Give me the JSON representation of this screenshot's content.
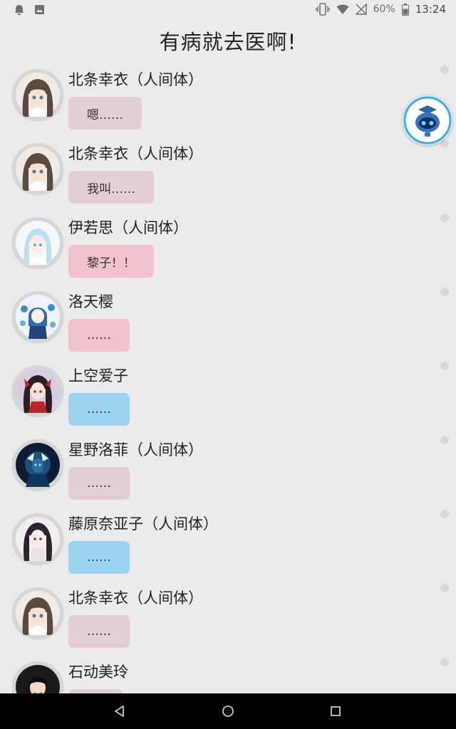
{
  "status_bar": {
    "battery": "60%",
    "time": "13:24"
  },
  "page": {
    "title": "有病就去医啊!"
  },
  "messages": [
    {
      "name": "北条幸衣（人间体）",
      "text": "嗯……",
      "bubble_color": "#e2cfd4",
      "avatar": "brown-hair-girl"
    },
    {
      "name": "北条幸衣（人间体）",
      "text": "我叫……",
      "bubble_color": "#e2cfd4",
      "avatar": "brown-hair-girl"
    },
    {
      "name": "伊若思（人间体）",
      "text": "黎子！！",
      "bubble_color": "#f2c3ce",
      "avatar": "light-blue-hair-girl"
    },
    {
      "name": "洛天樱",
      "text": "……",
      "bubble_color": "#f2c3ce",
      "avatar": "blue-flowers-girl"
    },
    {
      "name": "上空爱子",
      "text": "……",
      "bubble_color": "#9cd3f0",
      "avatar": "red-black-hair-girl"
    },
    {
      "name": "星野洛菲（人间体）",
      "text": "……",
      "bubble_color": "#e2cfd4",
      "avatar": "dark-blue-glow-figure"
    },
    {
      "name": "藤原奈亚子（人间体）",
      "text": "……",
      "bubble_color": "#9cd3f0",
      "avatar": "dark-hair-girl"
    },
    {
      "name": "北条幸衣（人间体）",
      "text": "……",
      "bubble_color": "#e2cfd4",
      "avatar": "brown-hair-girl"
    },
    {
      "name": "石动美玲",
      "text": "",
      "bubble_color": "#e2cfd4",
      "avatar": "photo-woman"
    }
  ],
  "assistant_bot": {
    "icon": "robot-assistant-icon"
  }
}
